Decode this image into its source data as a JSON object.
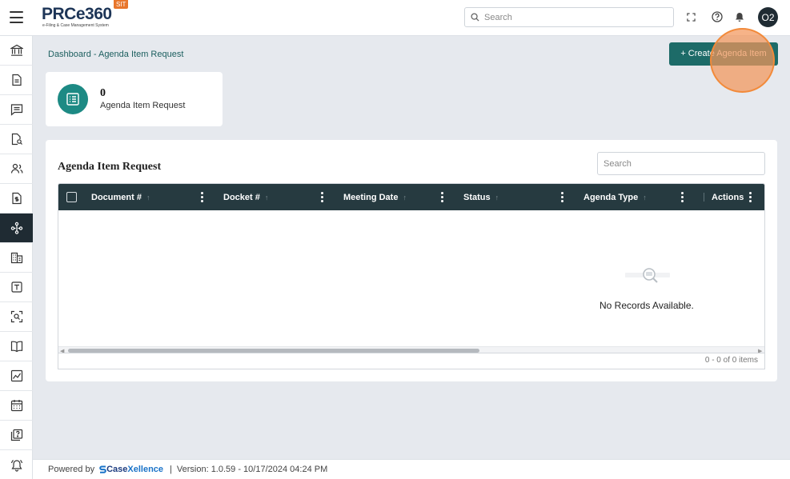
{
  "app": {
    "logo_text": "PRCe360",
    "logo_subtitle": "e-Filing & Case Management System",
    "env_badge": "SIT"
  },
  "header": {
    "search_placeholder": "Search",
    "avatar_initials": "O2"
  },
  "sidebar": {
    "items": [
      {
        "icon": "bank-icon"
      },
      {
        "icon": "document-icon"
      },
      {
        "icon": "comment-icon"
      },
      {
        "icon": "document-search-icon"
      },
      {
        "icon": "users-icon"
      },
      {
        "icon": "file-dollar-icon"
      },
      {
        "icon": "agenda-network-icon",
        "active": true
      },
      {
        "icon": "building-icon"
      },
      {
        "icon": "text-box-icon"
      },
      {
        "icon": "scan-search-icon"
      },
      {
        "icon": "book-open-icon"
      },
      {
        "icon": "chart-icon"
      },
      {
        "icon": "calendar-icon"
      },
      {
        "icon": "help-doc-icon"
      },
      {
        "icon": "bell-alert-icon"
      }
    ]
  },
  "breadcrumb": "Dashboard - Agenda Item Request",
  "create_button": "+ Create Agenda Item",
  "summary_card": {
    "count": "0",
    "label": "Agenda Item Request"
  },
  "panel": {
    "title": "Agenda Item Request",
    "search_placeholder": "Search",
    "columns": [
      "Document #",
      "Docket #",
      "Meeting Date",
      "Status",
      "Agenda Type",
      "Actions"
    ],
    "empty_message": "No Records Available.",
    "pagination": "0 - 0 of 0 items"
  },
  "footer": {
    "powered_by": "Powered by",
    "brand_prefix": "Case",
    "brand_suffix": "Xellence",
    "separator": "|",
    "version": "Version: 1.0.59 - 10/17/2024 04:24 PM"
  },
  "colors": {
    "accent": "#1d6b68",
    "sidebar_active": "#1f2b33",
    "table_header": "#263a40",
    "badge": "#e8762c"
  }
}
